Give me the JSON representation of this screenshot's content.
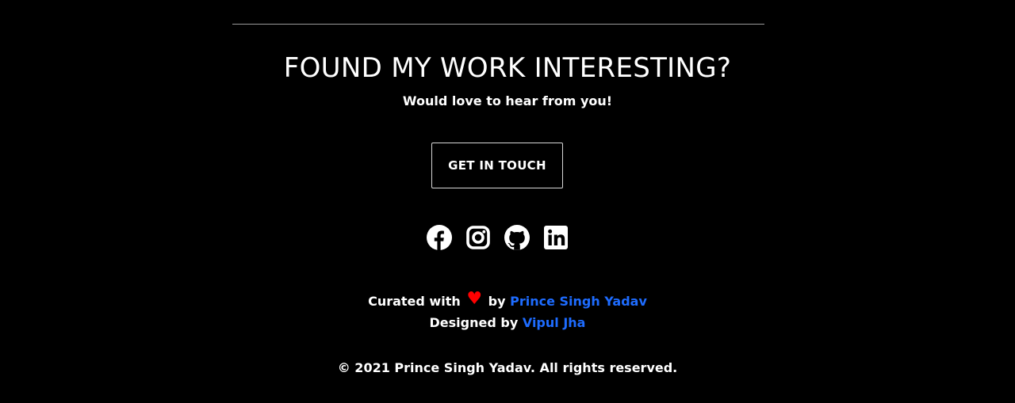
{
  "contact": {
    "heading": "FOUND MY WORK INTERESTING?",
    "subheading": "Would love to hear from you!",
    "cta_label": "GET IN TOUCH"
  },
  "social": [
    {
      "icon": "facebook-icon"
    },
    {
      "icon": "instagram-icon"
    },
    {
      "icon": "github-icon"
    },
    {
      "icon": "linkedin-icon"
    }
  ],
  "credits": {
    "curated_prefix": "Curated with",
    "heart": "♥",
    "by_text": "by",
    "curator_name": "Prince Singh Yadav",
    "designed_prefix": "Designed by",
    "designer_name": "Vipul Jha"
  },
  "copyright": "© 2021 Prince Singh Yadav. All rights reserved.",
  "colors": {
    "background": "#000000",
    "text": "#ffffff",
    "link": "#1e6cff",
    "heart": "#ff0000"
  }
}
